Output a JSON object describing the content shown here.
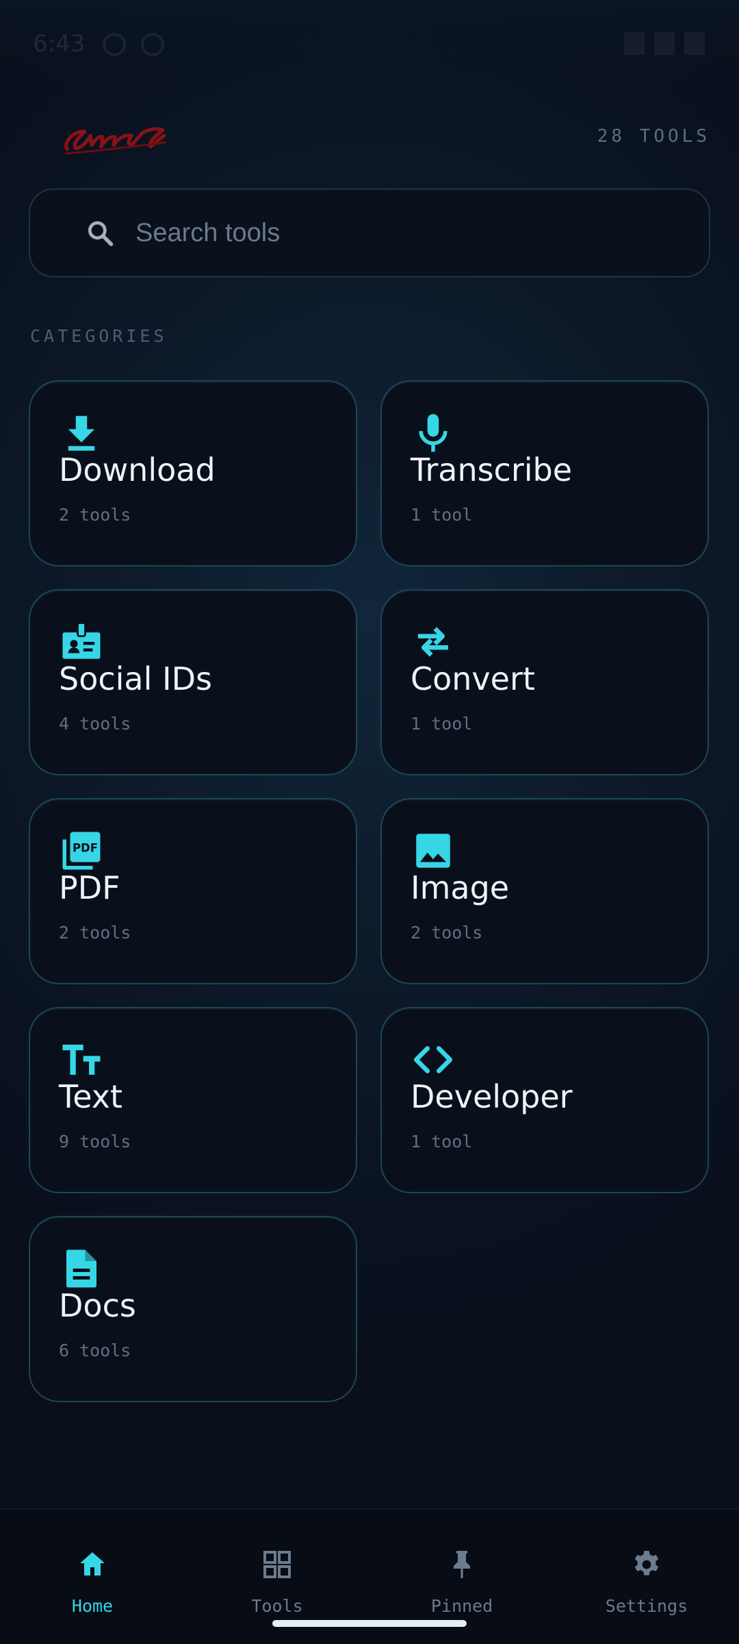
{
  "status_bar": {
    "time": "6:43"
  },
  "header": {
    "tools_count": "28 TOOLS"
  },
  "search": {
    "placeholder": "Search tools"
  },
  "section": {
    "label": "CATEGORIES"
  },
  "categories": [
    {
      "title": "Download",
      "count": "2 tools",
      "icon": "download-icon"
    },
    {
      "title": "Transcribe",
      "count": "1 tool",
      "icon": "microphone-icon"
    },
    {
      "title": "Social IDs",
      "count": "4 tools",
      "icon": "id-badge-icon"
    },
    {
      "title": "Convert",
      "count": "1 tool",
      "icon": "swap-arrows-icon"
    },
    {
      "title": "PDF",
      "count": "2 tools",
      "icon": "pdf-icon"
    },
    {
      "title": "Image",
      "count": "2 tools",
      "icon": "image-icon"
    },
    {
      "title": "Text",
      "count": "9 tools",
      "icon": "text-size-icon"
    },
    {
      "title": "Developer",
      "count": "1 tool",
      "icon": "code-icon"
    },
    {
      "title": "Docs",
      "count": "6 tools",
      "icon": "document-icon"
    }
  ],
  "nav": {
    "items": [
      {
        "label": "Home",
        "icon": "home-icon",
        "active": true
      },
      {
        "label": "Tools",
        "icon": "grid-icon",
        "active": false
      },
      {
        "label": "Pinned",
        "icon": "pin-icon",
        "active": false
      },
      {
        "label": "Settings",
        "icon": "gear-icon",
        "active": false
      }
    ]
  },
  "colors": {
    "accent": "#36d6e7",
    "background": "#0b1524",
    "card_border": "#1d4656",
    "logo": "#8a1216"
  }
}
